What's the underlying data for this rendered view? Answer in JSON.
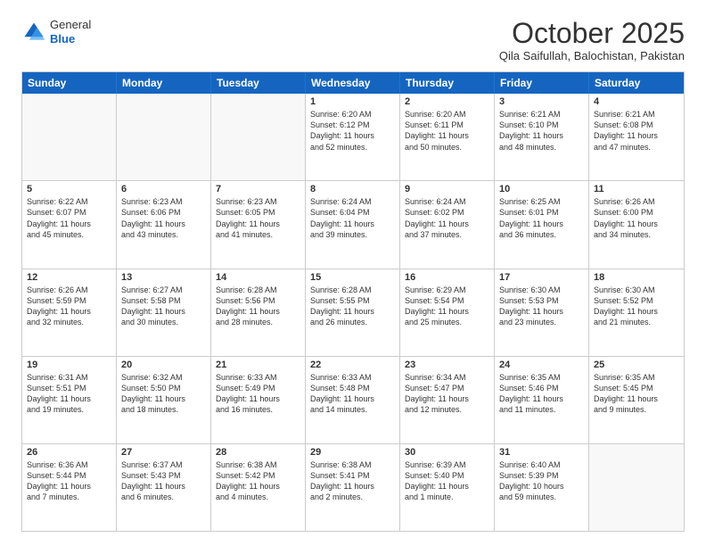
{
  "header": {
    "logo_general": "General",
    "logo_blue": "Blue",
    "month": "October 2025",
    "location": "Qila Saifullah, Balochistan, Pakistan"
  },
  "days_of_week": [
    "Sunday",
    "Monday",
    "Tuesday",
    "Wednesday",
    "Thursday",
    "Friday",
    "Saturday"
  ],
  "weeks": [
    [
      {
        "day": "",
        "empty": true
      },
      {
        "day": "",
        "empty": true
      },
      {
        "day": "",
        "empty": true
      },
      {
        "day": "1",
        "info": "Sunrise: 6:20 AM\nSunset: 6:12 PM\nDaylight: 11 hours\nand 52 minutes."
      },
      {
        "day": "2",
        "info": "Sunrise: 6:20 AM\nSunset: 6:11 PM\nDaylight: 11 hours\nand 50 minutes."
      },
      {
        "day": "3",
        "info": "Sunrise: 6:21 AM\nSunset: 6:10 PM\nDaylight: 11 hours\nand 48 minutes."
      },
      {
        "day": "4",
        "info": "Sunrise: 6:21 AM\nSunset: 6:08 PM\nDaylight: 11 hours\nand 47 minutes."
      }
    ],
    [
      {
        "day": "5",
        "info": "Sunrise: 6:22 AM\nSunset: 6:07 PM\nDaylight: 11 hours\nand 45 minutes."
      },
      {
        "day": "6",
        "info": "Sunrise: 6:23 AM\nSunset: 6:06 PM\nDaylight: 11 hours\nand 43 minutes."
      },
      {
        "day": "7",
        "info": "Sunrise: 6:23 AM\nSunset: 6:05 PM\nDaylight: 11 hours\nand 41 minutes."
      },
      {
        "day": "8",
        "info": "Sunrise: 6:24 AM\nSunset: 6:04 PM\nDaylight: 11 hours\nand 39 minutes."
      },
      {
        "day": "9",
        "info": "Sunrise: 6:24 AM\nSunset: 6:02 PM\nDaylight: 11 hours\nand 37 minutes."
      },
      {
        "day": "10",
        "info": "Sunrise: 6:25 AM\nSunset: 6:01 PM\nDaylight: 11 hours\nand 36 minutes."
      },
      {
        "day": "11",
        "info": "Sunrise: 6:26 AM\nSunset: 6:00 PM\nDaylight: 11 hours\nand 34 minutes."
      }
    ],
    [
      {
        "day": "12",
        "info": "Sunrise: 6:26 AM\nSunset: 5:59 PM\nDaylight: 11 hours\nand 32 minutes."
      },
      {
        "day": "13",
        "info": "Sunrise: 6:27 AM\nSunset: 5:58 PM\nDaylight: 11 hours\nand 30 minutes."
      },
      {
        "day": "14",
        "info": "Sunrise: 6:28 AM\nSunset: 5:56 PM\nDaylight: 11 hours\nand 28 minutes."
      },
      {
        "day": "15",
        "info": "Sunrise: 6:28 AM\nSunset: 5:55 PM\nDaylight: 11 hours\nand 26 minutes."
      },
      {
        "day": "16",
        "info": "Sunrise: 6:29 AM\nSunset: 5:54 PM\nDaylight: 11 hours\nand 25 minutes."
      },
      {
        "day": "17",
        "info": "Sunrise: 6:30 AM\nSunset: 5:53 PM\nDaylight: 11 hours\nand 23 minutes."
      },
      {
        "day": "18",
        "info": "Sunrise: 6:30 AM\nSunset: 5:52 PM\nDaylight: 11 hours\nand 21 minutes."
      }
    ],
    [
      {
        "day": "19",
        "info": "Sunrise: 6:31 AM\nSunset: 5:51 PM\nDaylight: 11 hours\nand 19 minutes."
      },
      {
        "day": "20",
        "info": "Sunrise: 6:32 AM\nSunset: 5:50 PM\nDaylight: 11 hours\nand 18 minutes."
      },
      {
        "day": "21",
        "info": "Sunrise: 6:33 AM\nSunset: 5:49 PM\nDaylight: 11 hours\nand 16 minutes."
      },
      {
        "day": "22",
        "info": "Sunrise: 6:33 AM\nSunset: 5:48 PM\nDaylight: 11 hours\nand 14 minutes."
      },
      {
        "day": "23",
        "info": "Sunrise: 6:34 AM\nSunset: 5:47 PM\nDaylight: 11 hours\nand 12 minutes."
      },
      {
        "day": "24",
        "info": "Sunrise: 6:35 AM\nSunset: 5:46 PM\nDaylight: 11 hours\nand 11 minutes."
      },
      {
        "day": "25",
        "info": "Sunrise: 6:35 AM\nSunset: 5:45 PM\nDaylight: 11 hours\nand 9 minutes."
      }
    ],
    [
      {
        "day": "26",
        "info": "Sunrise: 6:36 AM\nSunset: 5:44 PM\nDaylight: 11 hours\nand 7 minutes."
      },
      {
        "day": "27",
        "info": "Sunrise: 6:37 AM\nSunset: 5:43 PM\nDaylight: 11 hours\nand 6 minutes."
      },
      {
        "day": "28",
        "info": "Sunrise: 6:38 AM\nSunset: 5:42 PM\nDaylight: 11 hours\nand 4 minutes."
      },
      {
        "day": "29",
        "info": "Sunrise: 6:38 AM\nSunset: 5:41 PM\nDaylight: 11 hours\nand 2 minutes."
      },
      {
        "day": "30",
        "info": "Sunrise: 6:39 AM\nSunset: 5:40 PM\nDaylight: 11 hours\nand 1 minute."
      },
      {
        "day": "31",
        "info": "Sunrise: 6:40 AM\nSunset: 5:39 PM\nDaylight: 10 hours\nand 59 minutes."
      },
      {
        "day": "",
        "empty": true
      }
    ]
  ]
}
